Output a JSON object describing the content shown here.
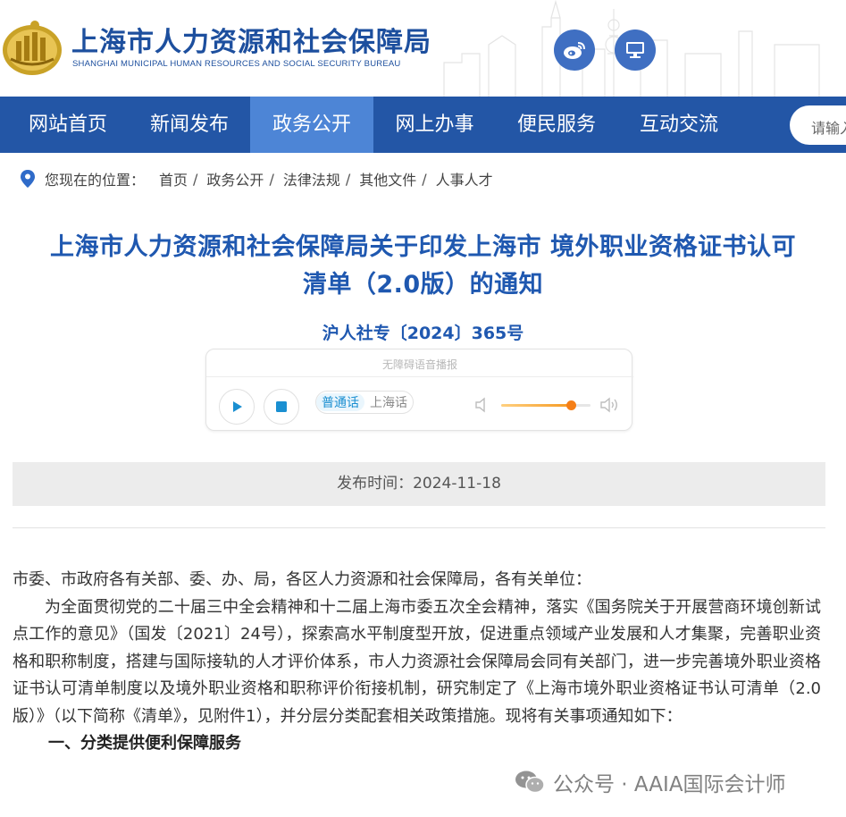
{
  "header": {
    "title": "上海市人力资源和社会保障局",
    "subtitle": "SHANGHAI MUNICIPAL HUMAN RESOURCES AND SOCIAL SECURITY BUREAU",
    "icons": [
      "weibo-icon",
      "desktop-icon"
    ]
  },
  "nav": {
    "items": [
      {
        "label": "网站首页"
      },
      {
        "label": "新闻发布"
      },
      {
        "label": "政务公开",
        "active": true
      },
      {
        "label": "网上办事"
      },
      {
        "label": "便民服务"
      },
      {
        "label": "互动交流"
      }
    ],
    "search_placeholder": "请输入"
  },
  "breadcrumb": {
    "prefix": "您现在的位置：",
    "items": [
      "首页",
      "政务公开",
      "法律法规",
      "其他文件",
      "人事人才"
    ],
    "separator": "/"
  },
  "document": {
    "title_line1": "上海市人力资源和社会保障局关于印发上海市 境外职业资格证书认可",
    "title_line2": "清单（2.0版）的通知",
    "number": "沪人社专〔2024〕365号",
    "publish_label": "发布时间：",
    "publish_date": "2024-11-18"
  },
  "audio": {
    "label": "无障碍语音播报",
    "lang_selected": "普通话",
    "lang_other": "上海话",
    "volume": 0.78
  },
  "body": {
    "salutation": "市委、市政府各有关部、委、办、局，各区人力资源和社会保障局，各有关单位：",
    "paragraph1": "为全面贯彻党的二十届三中全会精神和十二届上海市委五次全会精神，落实《国务院关于开展营商环境创新试点工作的意见》（国发〔2021〕24号），探索高水平制度型开放，促进重点领域产业发展和人才集聚，完善职业资格和职称制度，搭建与国际接轨的人才评价体系，市人力资源社会保障局会同有关部门，进一步完善境外职业资格证书认可清单制度以及境外职业资格和职称评价衔接机制，研究制定了《上海市境外职业资格证书认可清单（2.0版）》（以下简称《清单》，见附件1），并分层分类配套相关政策措施。现将有关事项通知如下：",
    "section1": "一、分类提供便利保障服务"
  },
  "watermark": {
    "text": "公众号 · AAIA国际会计师"
  },
  "colors": {
    "brand": "#1d4f9e",
    "nav_bg": "#2356a6",
    "nav_active": "#4d85d6",
    "title": "#1f58b0",
    "volume_accent": "#f57f17"
  }
}
